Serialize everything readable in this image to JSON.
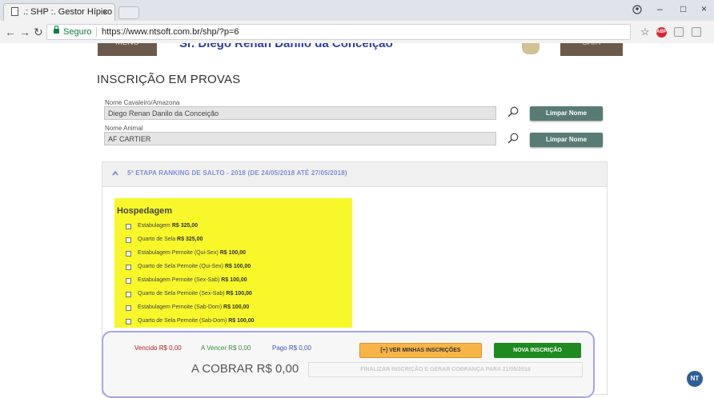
{
  "browser": {
    "tab_title": ".: SHP :. Gestor Hípico",
    "tab_close": "×",
    "seguro": "Seguro",
    "url": "https://www.ntsoft.com.br/shp/?p=6",
    "minimize": "–",
    "maximize": "□",
    "close": "×"
  },
  "header": {
    "menu_label": "MENU",
    "user_name": "Sr. Diego Renan Danilo da Conceição",
    "exit_label": "SAIR"
  },
  "page": {
    "title": "INSCRIÇÃO EM PROVAS",
    "rider_label": "Nome Cavaleiro/Amazona",
    "rider_value": "Diego Renan Danilo da Conceição",
    "animal_label": "Nome Animal",
    "animal_value": "AF CARTIER",
    "clear_name_btn": "Limpar Nome",
    "clear_animal_btn": "Limpar Nome"
  },
  "event": {
    "title": "5ª ETAPA RANKING DE SALTO - 2018    (DE 24/05/2018 ATÉ 27/05/2018)"
  },
  "hospedagem": {
    "title": "Hospedagem",
    "items": [
      {
        "label": "Estabulagem",
        "price": "R$ 325,00"
      },
      {
        "label": "Quarto de Sela",
        "price": "R$ 325,00"
      },
      {
        "label": "Estabulagem Pernoite (Qui-Sex)",
        "price": "R$ 100,00"
      },
      {
        "label": "Quarto de Sela Pernoite (Qui-Sex)",
        "price": "R$ 100,00"
      },
      {
        "label": "Estabulagem Pernoite (Sex-Sab)",
        "price": "R$ 100,00"
      },
      {
        "label": "Quarto de Sela Pernoite (Sex-Sab)",
        "price": "R$ 100,00"
      },
      {
        "label": "Estabulagem Pernoite (Sab-Dom)",
        "price": "R$ 100,00"
      },
      {
        "label": "Quarto de Sela Pernoite (Sab-Dom)",
        "price": "R$ 100,00"
      }
    ]
  },
  "summary": {
    "vencido": "Vencido R$ 0,00",
    "a_vencer": "A Vencer R$ 0,00",
    "pago": "Pago R$ 0,00",
    "ver_btn": "[+] VER MINHAS INSCRIÇÕES",
    "nova_btn": "NOVA INSCRIÇÃO",
    "a_cobrar": "A COBRAR R$ 0,00",
    "finalizar_btn": "FINALIZAR INSCRIÇÃO E GERAR COBRANÇA PARA 21/05/2018",
    "logo_text": "NT"
  },
  "colors": {
    "accent_green": "#1f8a1f",
    "accent_orange": "#f7b548",
    "highlight_yellow": "#f7f72a",
    "header_brown": "#6b5a4b"
  }
}
